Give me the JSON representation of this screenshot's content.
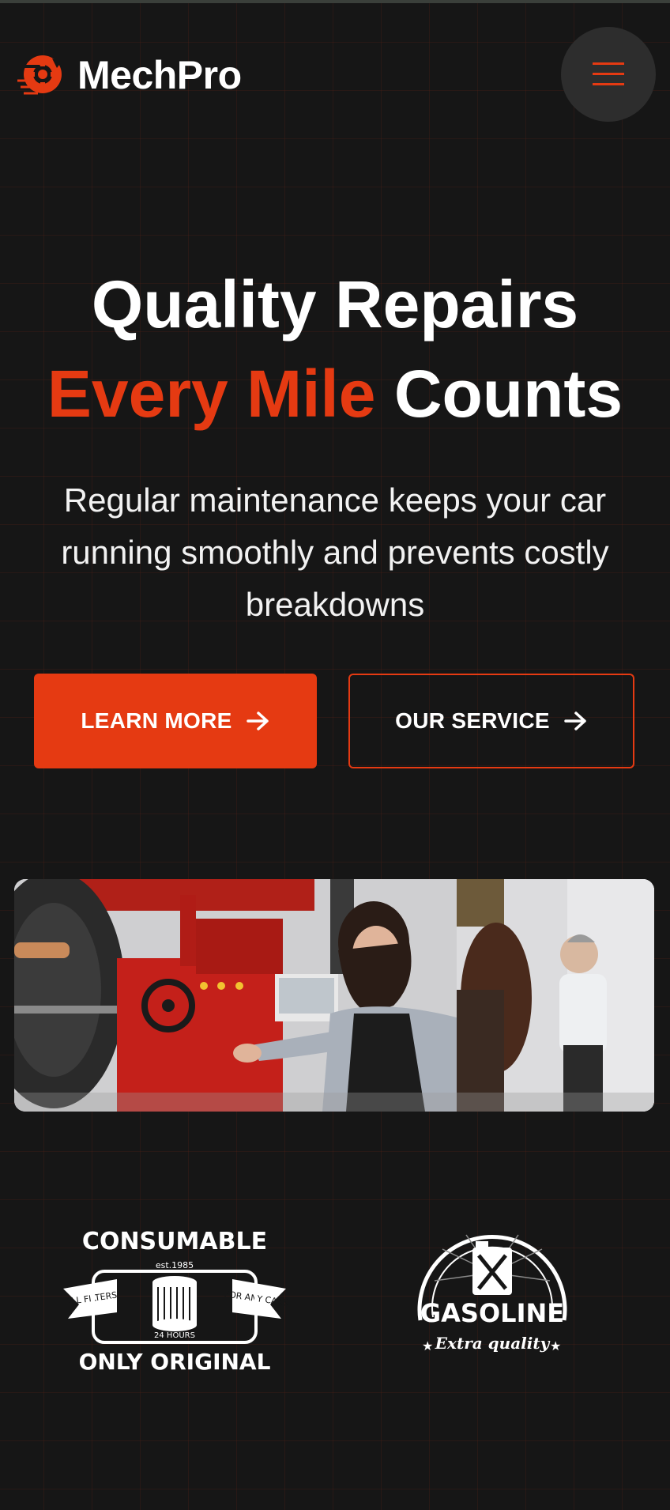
{
  "brand": {
    "name": "MechPro",
    "accent_color": "#e53a12",
    "logo_icon": "gear-wheel-logo-icon"
  },
  "header": {
    "menu_icon": "hamburger-menu-icon"
  },
  "hero": {
    "title_line1": "Quality Repairs",
    "title_line2_accent": "Every Mile",
    "title_line2_rest": "Counts",
    "subtitle": "Regular maintenance keeps your car running smoothly and prevents costly breakdowns",
    "primary_button": "LEARN MORE",
    "secondary_button": "OUR SERVICE"
  },
  "photo": {
    "icon": "workshop-photo"
  },
  "partners": [
    {
      "name": "consumable-badge",
      "top_text": "CONSUMABLE",
      "est_text": "est.1985",
      "left_ribbon": "ALL FILTERS",
      "right_ribbon": "FOR ANY CARS",
      "hours_text": "24 HOURS",
      "bottom_text": "ONLY ORIGINAL"
    },
    {
      "name": "gasoline-badge",
      "title": "GASOLINE",
      "tagline": "Extra quality"
    }
  ]
}
